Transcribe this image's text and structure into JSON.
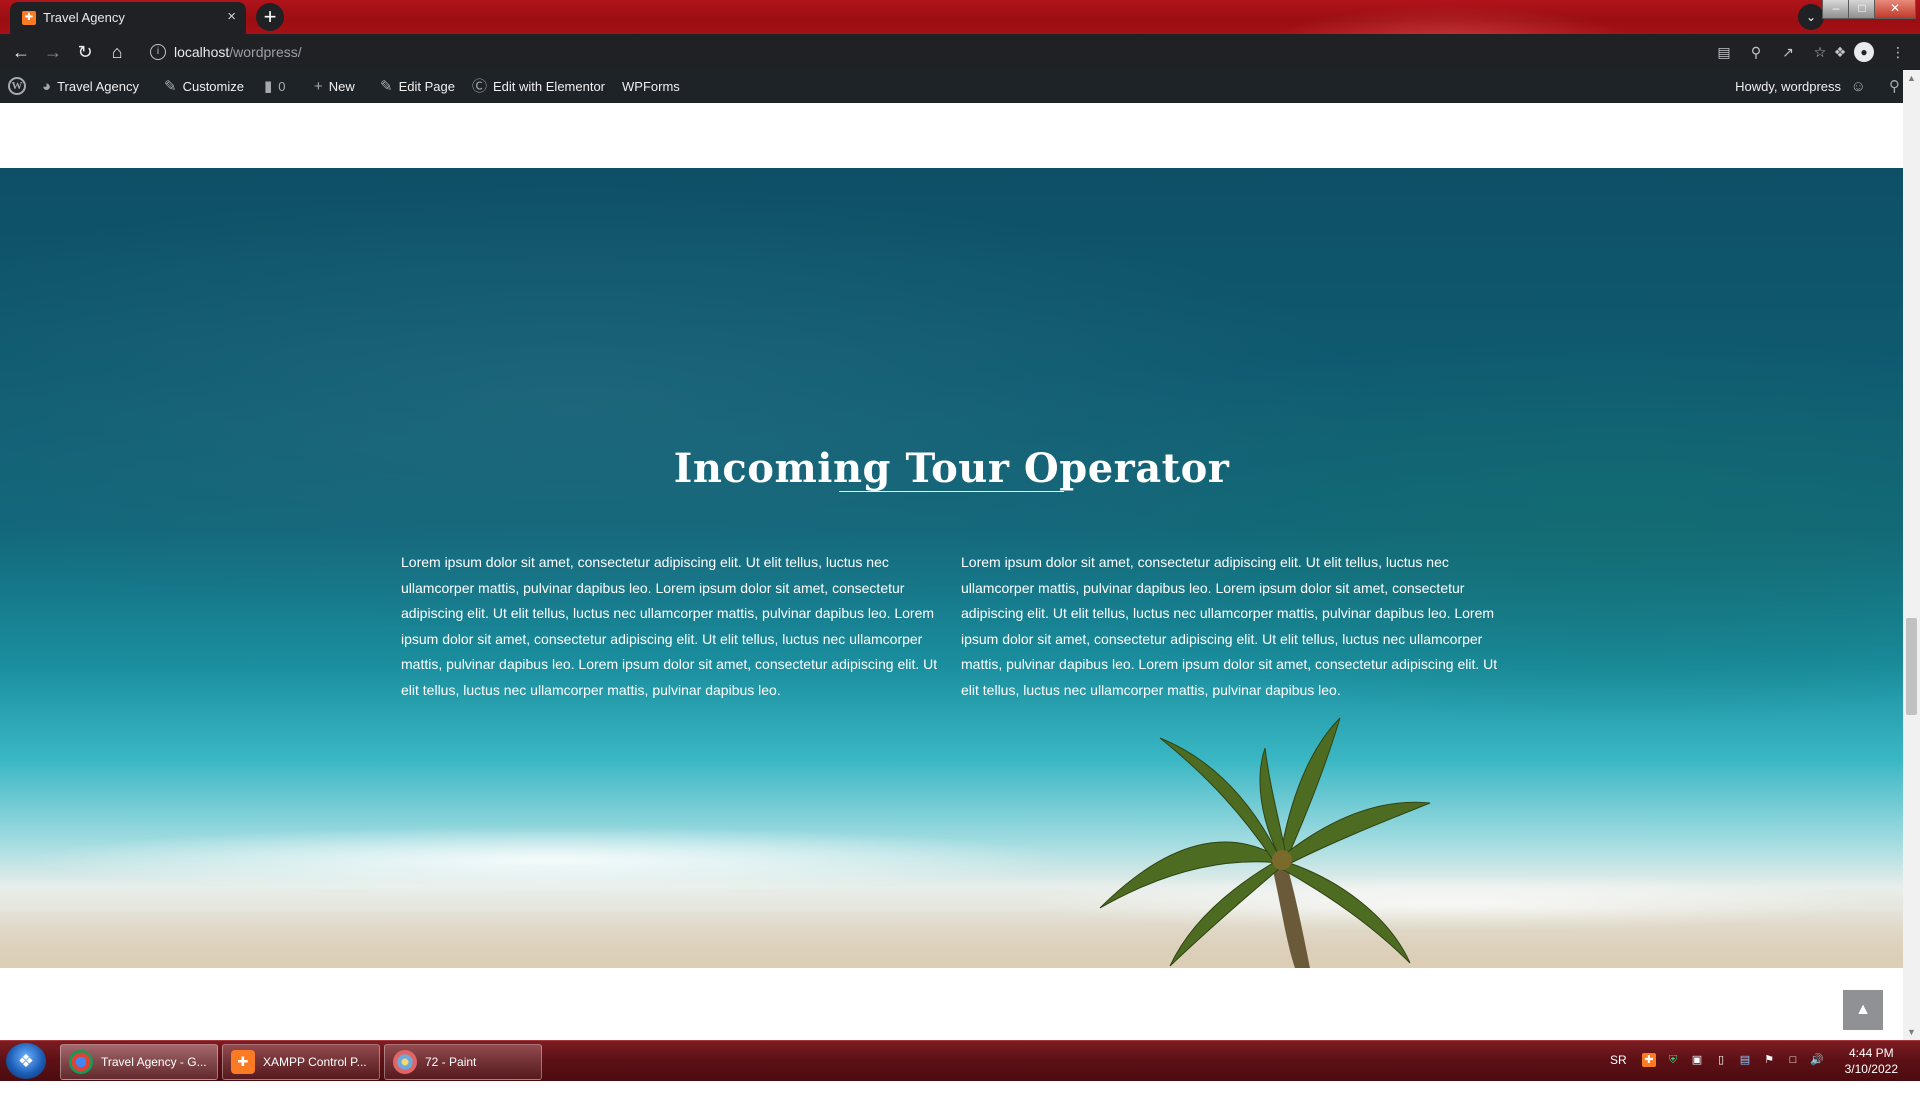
{
  "browser": {
    "tab_title": "Travel Agency",
    "tab_close": "×",
    "new_tab": "+",
    "url_host": "localhost",
    "url_path": "/wordpress/",
    "window_controls": {
      "minimize": "–",
      "maximize": "□",
      "close": "✕"
    }
  },
  "adminbar": {
    "site_name": "Travel Agency",
    "customize": "Customize",
    "comments_count": "0",
    "new": "New",
    "edit_page": "Edit Page",
    "edit_elementor": "Edit with Elementor",
    "wpforms": "WPForms",
    "howdy": "Howdy, wordpress"
  },
  "hero": {
    "title": "Incoming Tour Operator",
    "col_left": "Lorem ipsum dolor sit amet, consectetur adipiscing elit. Ut elit tellus, luctus nec ullamcorper mattis, pulvinar dapibus leo. Lorem ipsum dolor sit amet, consectetur adipiscing elit. Ut elit tellus, luctus nec ullamcorper mattis, pulvinar dapibus leo. Lorem ipsum dolor sit amet, consectetur adipiscing elit. Ut elit tellus, luctus nec ullamcorper mattis, pulvinar dapibus leo. Lorem ipsum dolor sit amet, consectetur adipiscing elit. Ut elit tellus, luctus nec ullamcorper mattis, pulvinar dapibus leo.",
    "col_right": "Lorem ipsum dolor sit amet, consectetur adipiscing elit. Ut elit tellus, luctus nec ullamcorper mattis, pulvinar dapibus leo. Lorem ipsum dolor sit amet, consectetur adipiscing elit. Ut elit tellus, luctus nec ullamcorper mattis, pulvinar dapibus leo. Lorem ipsum dolor sit amet, consectetur adipiscing elit. Ut elit tellus, luctus nec ullamcorper mattis, pulvinar dapibus leo. Lorem ipsum dolor sit amet, consectetur adipiscing elit. Ut elit tellus, luctus nec ullamcorper mattis, pulvinar dapibus leo."
  },
  "taskbar": {
    "items": [
      {
        "label": "Travel Agency - G...",
        "icon": "chrome-icon"
      },
      {
        "label": "XAMPP Control P...",
        "icon": "xampp-icon"
      },
      {
        "label": "72 - Paint",
        "icon": "paint-icon"
      }
    ],
    "language": "SR",
    "time": "4:44 PM",
    "date": "3/10/2022"
  },
  "colors": {
    "chrome_frame": "#a51116",
    "toolbar": "#202124",
    "adminbar": "#1d2327",
    "taskbar": "#5e1116"
  }
}
